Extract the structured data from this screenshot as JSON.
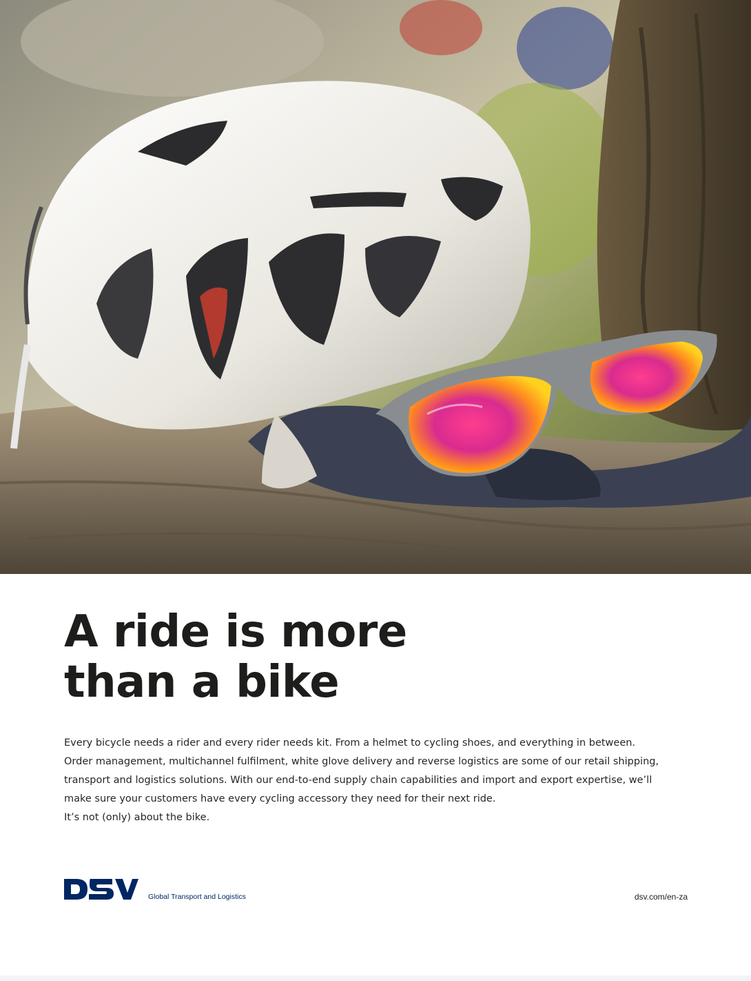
{
  "headline": {
    "line1": "A ride is more",
    "line2": "than a bike"
  },
  "body": {
    "lines": [
      "Every bicycle needs a rider and every rider needs kit. From a helmet to cycling shoes, and everything in between.",
      "Order management, multichannel fulfilment, white glove delivery and reverse logistics are some of our retail shipping,",
      "transport and logistics solutions. With our end-to-end supply chain capabilities and import and export expertise, we’ll",
      "make sure your customers have every cycling accessory they need for their next ride.",
      "It’s not (only) about the bike."
    ]
  },
  "brand": {
    "logo_text": "DSV",
    "tagline": "Global Transport and Logistics",
    "color": "#002664"
  },
  "footer": {
    "url": "dsv.com/en-za"
  },
  "hero": {
    "icons": [
      "bicycle-helmet",
      "sunglasses",
      "cycling-gloves"
    ]
  }
}
